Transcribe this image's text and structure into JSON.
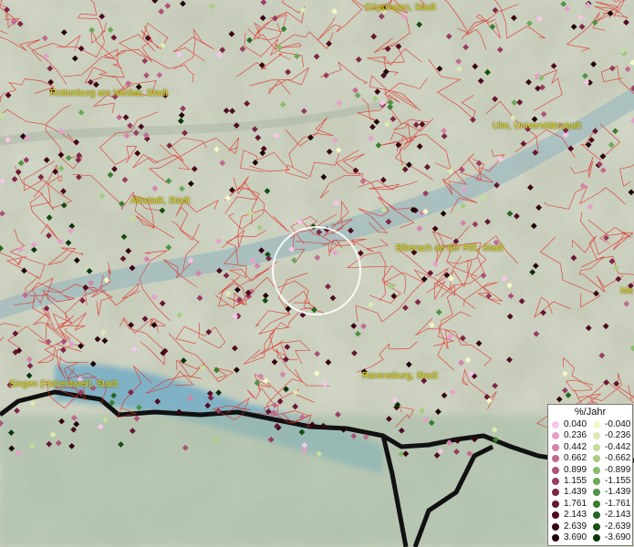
{
  "map": {
    "cities": [
      {
        "name": "Göppingen, Stadt",
        "pos": [
          400,
          3
        ]
      },
      {
        "name": "Rottenburg am Neckar, Stadt",
        "pos": [
          55,
          97
        ]
      },
      {
        "name": "Ulm, Universitätsstadt",
        "pos": [
          540,
          133
        ]
      },
      {
        "name": "Albstadt, Stadt",
        "pos": [
          143,
          215
        ]
      },
      {
        "name": "Biberach an der Riß, Stadt",
        "pos": [
          434,
          267
        ]
      },
      {
        "name": "Me",
        "pos": [
          680,
          314
        ]
      },
      {
        "name": "Singen (Hohentwiel), Stadt",
        "pos": [
          10,
          416
        ]
      },
      {
        "name": "Ravensburg, Stadt",
        "pos": [
          397,
          407
        ]
      }
    ]
  },
  "legend": {
    "title": "%/Jahr",
    "positive": [
      "0.040",
      "0.236",
      "0.442",
      "0.662",
      "0.899",
      "1.155",
      "1.439",
      "1.761",
      "2.143",
      "2.639",
      "3.690"
    ],
    "negative": [
      "-0.040",
      "-0.236",
      "-0.442",
      "-0.662",
      "-0.899",
      "-1.155",
      "-1.439",
      "-1.761",
      "-2.143",
      "-2.639",
      "-3.690"
    ],
    "positive_colors": [
      "#f6c6ec",
      "#e6a0cc",
      "#d483ad",
      "#c06a90",
      "#ab5278",
      "#973c62",
      "#7e2646",
      "#661632",
      "#4e0a20",
      "#380412",
      "#1e0208"
    ],
    "negative_colors": [
      "#f4f7c6",
      "#dcebb0",
      "#c4de98",
      "#a6cd82",
      "#88bc6c",
      "#6aa958",
      "#4f9444",
      "#387e30",
      "#24661f",
      "#144e12",
      "#083608"
    ]
  }
}
